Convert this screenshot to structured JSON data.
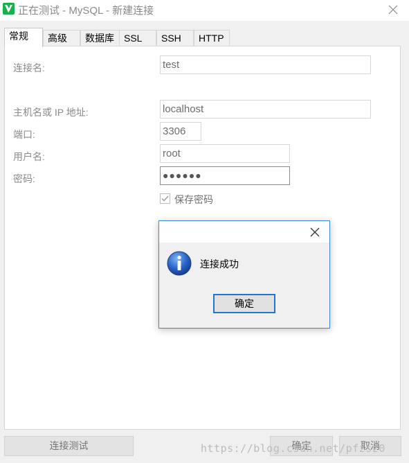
{
  "window": {
    "title": "正在测试 - MySQL - 新建连接",
    "app_icon": "navicat-dolphin-icon",
    "close_icon": "close-icon"
  },
  "tabs": [
    {
      "label": "常规",
      "active": true
    },
    {
      "label": "高级",
      "active": false
    },
    {
      "label": "数据库",
      "active": false
    },
    {
      "label": "SSL",
      "active": false
    },
    {
      "label": "SSH",
      "active": false
    },
    {
      "label": "HTTP",
      "active": false
    }
  ],
  "form": {
    "connection_name_label": "连接名:",
    "connection_name_value": "test",
    "host_label": "主机名或 IP 地址:",
    "host_value": "localhost",
    "port_label": "端口:",
    "port_value": "3306",
    "user_label": "用户名:",
    "user_value": "root",
    "password_label": "密码:",
    "password_value": "●●●●●●",
    "save_password_label": "保存密码",
    "save_password_checked": true
  },
  "buttons": {
    "test_connection": "连接测试",
    "ok": "确定",
    "cancel": "取消"
  },
  "watermark": "https://blog.csdn.net/pfzsz0",
  "dialog": {
    "icon": "info-icon",
    "message": "连接成功",
    "ok_label": "确定"
  },
  "colors": {
    "accent_blue": "#1f75cf",
    "dialog_border": "#3c86d6",
    "app_icon_green": "#16b14b"
  }
}
